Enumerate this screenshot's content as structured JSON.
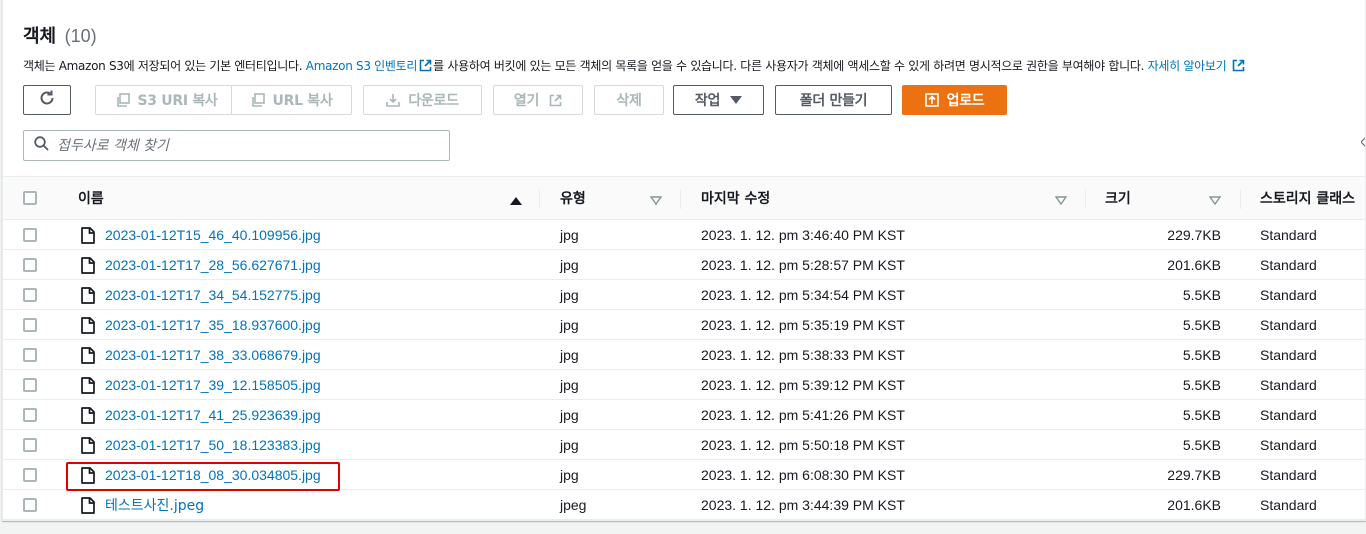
{
  "header": {
    "title": "객체",
    "count": "(10)"
  },
  "description": {
    "part1": "객체는 Amazon S3에 저장되어 있는 기본 엔터티입니다. ",
    "inventory_link": "Amazon S3 인벤토리",
    "part2": "를 사용하여 버킷에 있는 모든 객체의 목록을 얻을 수 있습니다. 다른 사용자가 객체에 액세스할 수 있게 하려면 명시적으로 권한을 부여해야 합니다. ",
    "learn_more_link": "자세히 알아보기"
  },
  "toolbar": {
    "copy_s3_uri": "S3 URI 복사",
    "copy_url": "URL 복사",
    "download": "다운로드",
    "open": "열기",
    "delete": "삭제",
    "actions": "작업",
    "create_folder": "폴더 만들기",
    "upload": "업로드"
  },
  "search": {
    "placeholder": "접두사로 객체 찾기"
  },
  "table": {
    "columns": {
      "name": "이름",
      "type": "유형",
      "modified": "마지막 수정",
      "size": "크기",
      "storage": "스토리지 클래스"
    },
    "rows": [
      {
        "name": "2023-01-12T15_46_40.109956.jpg",
        "type": "jpg",
        "modified": "2023. 1. 12. pm 3:46:40 PM KST",
        "size": "229.7KB",
        "storage": "Standard"
      },
      {
        "name": "2023-01-12T17_28_56.627671.jpg",
        "type": "jpg",
        "modified": "2023. 1. 12. pm 5:28:57 PM KST",
        "size": "201.6KB",
        "storage": "Standard"
      },
      {
        "name": "2023-01-12T17_34_54.152775.jpg",
        "type": "jpg",
        "modified": "2023. 1. 12. pm 5:34:54 PM KST",
        "size": "5.5KB",
        "storage": "Standard"
      },
      {
        "name": "2023-01-12T17_35_18.937600.jpg",
        "type": "jpg",
        "modified": "2023. 1. 12. pm 5:35:19 PM KST",
        "size": "5.5KB",
        "storage": "Standard"
      },
      {
        "name": "2023-01-12T17_38_33.068679.jpg",
        "type": "jpg",
        "modified": "2023. 1. 12. pm 5:38:33 PM KST",
        "size": "5.5KB",
        "storage": "Standard"
      },
      {
        "name": "2023-01-12T17_39_12.158505.jpg",
        "type": "jpg",
        "modified": "2023. 1. 12. pm 5:39:12 PM KST",
        "size": "5.5KB",
        "storage": "Standard"
      },
      {
        "name": "2023-01-12T17_41_25.923639.jpg",
        "type": "jpg",
        "modified": "2023. 1. 12. pm 5:41:26 PM KST",
        "size": "5.5KB",
        "storage": "Standard"
      },
      {
        "name": "2023-01-12T17_50_18.123383.jpg",
        "type": "jpg",
        "modified": "2023. 1. 12. pm 5:50:18 PM KST",
        "size": "5.5KB",
        "storage": "Standard"
      },
      {
        "name": "2023-01-12T18_08_30.034805.jpg",
        "type": "jpg",
        "modified": "2023. 1. 12. pm 6:08:30 PM KST",
        "size": "229.7KB",
        "storage": "Standard"
      },
      {
        "name": "테스트사진.jpeg",
        "type": "jpeg",
        "modified": "2023. 1. 12. pm 3:44:39 PM KST",
        "size": "201.6KB",
        "storage": "Standard"
      }
    ]
  },
  "colors": {
    "link": "#0073bb",
    "primary": "#ec7211",
    "highlight": "#e00000"
  }
}
